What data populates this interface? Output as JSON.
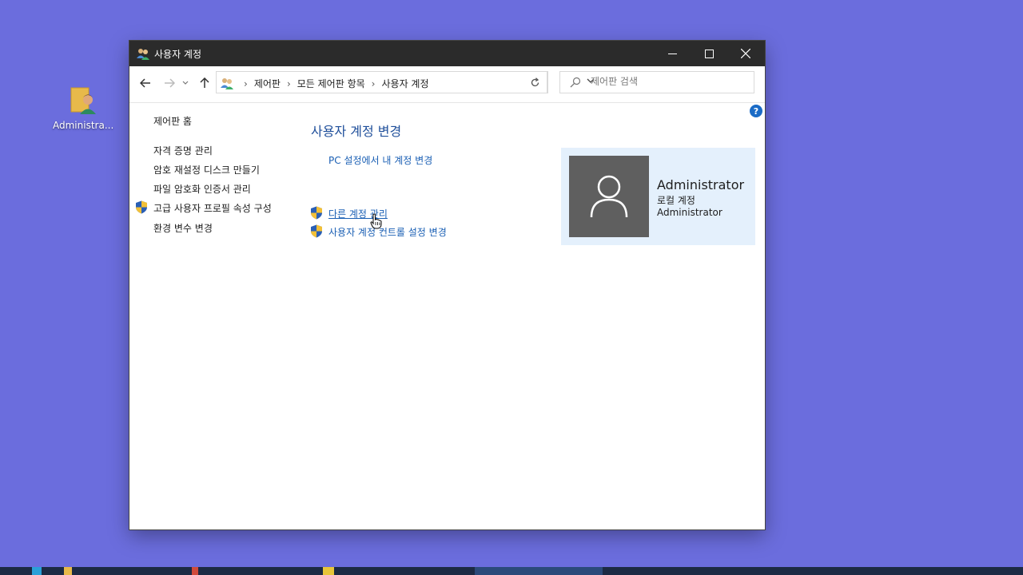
{
  "desktop": {
    "icon_label": "Administra..."
  },
  "window": {
    "title": "사용자 계정",
    "controls": {
      "minimize": "—",
      "maximize": "☐",
      "close": "✕"
    }
  },
  "address_bar": {
    "crumbs": [
      "제어판",
      "모든 제어판 항목",
      "사용자 계정"
    ],
    "separator": "›"
  },
  "search": {
    "placeholder": "제어판 검색"
  },
  "help": {
    "label": "?"
  },
  "left_pane": {
    "home": "제어판 홈",
    "items": [
      {
        "label": "자격 증명 관리",
        "shield": false
      },
      {
        "label": "암호 재설정 디스크 만들기",
        "shield": false
      },
      {
        "label": "파일 암호화 인증서 관리",
        "shield": false
      },
      {
        "label": "고급 사용자 프로필 속성 구성",
        "shield": true
      },
      {
        "label": "환경 변수 변경",
        "shield": false
      }
    ]
  },
  "main": {
    "heading": "사용자 계정 변경",
    "links": [
      {
        "label": "PC 설정에서 내 계정 변경",
        "shield": false
      },
      {
        "label": "다른 계정 관리",
        "shield": true,
        "hovered": true
      },
      {
        "label": "사용자 계정 컨트롤 설정 변경",
        "shield": true
      }
    ]
  },
  "user_tile": {
    "name": "Administrator",
    "type": "로컬 계정",
    "group": "Administrator"
  },
  "colors": {
    "desktop_bg": "#6b6ddd",
    "titlebar": "#2b2b2b",
    "link": "#1a5fb4",
    "heading": "#1e4e9a",
    "tile_bg": "#e4f0fc",
    "avatar_bg": "#5f5f5f"
  }
}
